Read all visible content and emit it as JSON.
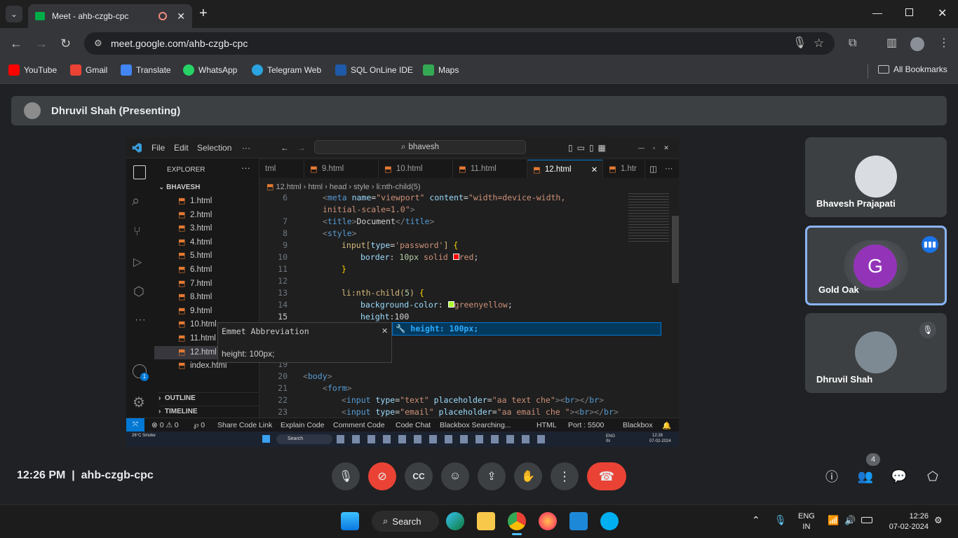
{
  "browser": {
    "tab_title": "Meet - ahb-czgb-cpc",
    "new_tab": "+",
    "url": "meet.google.com/ahb-czgb-cpc",
    "bookmarks": [
      {
        "label": "YouTube",
        "color": "#ff0000"
      },
      {
        "label": "Gmail",
        "color": "#ea4335"
      },
      {
        "label": "Translate",
        "color": "#4285f4"
      },
      {
        "label": "WhatsApp",
        "color": "#25d366"
      },
      {
        "label": "Telegram Web",
        "color": "#2aa3e0"
      },
      {
        "label": "SQL OnLine IDE",
        "color": "#1e5aa8"
      },
      {
        "label": "Maps",
        "color": "#34a853"
      }
    ],
    "all_bookmarks": "All Bookmarks"
  },
  "meet": {
    "presenter_bar": "Dhruvil Shah (Presenting)",
    "time": "12:26 PM",
    "separator": "|",
    "meeting_code": "ahb-czgb-cpc",
    "participants_count": "4",
    "participants": [
      {
        "name": "Bhavesh Prajapati"
      },
      {
        "name": "Gold Oak",
        "initial": "G",
        "avatar_color": "#9334b8"
      },
      {
        "name": "Dhruvil Shah"
      }
    ]
  },
  "vscode": {
    "menu": [
      "File",
      "Edit",
      "Selection",
      "···"
    ],
    "search": "bhavesh",
    "explorer_title": "EXPLORER",
    "folder": "BHAVESH",
    "files": [
      "1.html",
      "2.html",
      "3.html",
      "4.html",
      "5.html",
      "6.html",
      "7.html",
      "8.html",
      "9.html",
      "10.html",
      "11.html",
      "12.html",
      "index.html"
    ],
    "outline": "OUTLINE",
    "timeline": "TIMELINE",
    "tabs": [
      "tml",
      "9.html",
      "10.html",
      "11.html",
      "12.html",
      "1.htr"
    ],
    "breadcrumb": [
      "12.html",
      "html",
      "head",
      "style",
      "li:nth-child(5)"
    ],
    "emmet_title": "Emmet Abbreviation",
    "emmet_body": "height: 100px;",
    "suggest": "height: 100px;",
    "line_numbers": [
      "6",
      "",
      "7",
      "8",
      "9",
      "10",
      "11",
      "12",
      "13",
      "14",
      "15",
      "",
      "",
      "",
      "19",
      "20",
      "21",
      "22",
      "23"
    ],
    "status": [
      "⊗ 0 ⚠ 0",
      "℘ 0",
      "Share Code Link",
      "Explain Code",
      "Comment Code",
      "Code Chat",
      "Blackbox Searching...",
      "HTML",
      "Port : 5500",
      "Blackbox"
    ],
    "inner_task_time": "12:26",
    "inner_task_date": "07-02-2024",
    "inner_weather": "26°C Smoke",
    "inner_search": "Search",
    "inner_lang": "ENG IN"
  },
  "taskbar": {
    "search": "Search",
    "lang_top": "ENG",
    "lang_bottom": "IN",
    "time": "12:26",
    "date": "07-02-2024"
  }
}
